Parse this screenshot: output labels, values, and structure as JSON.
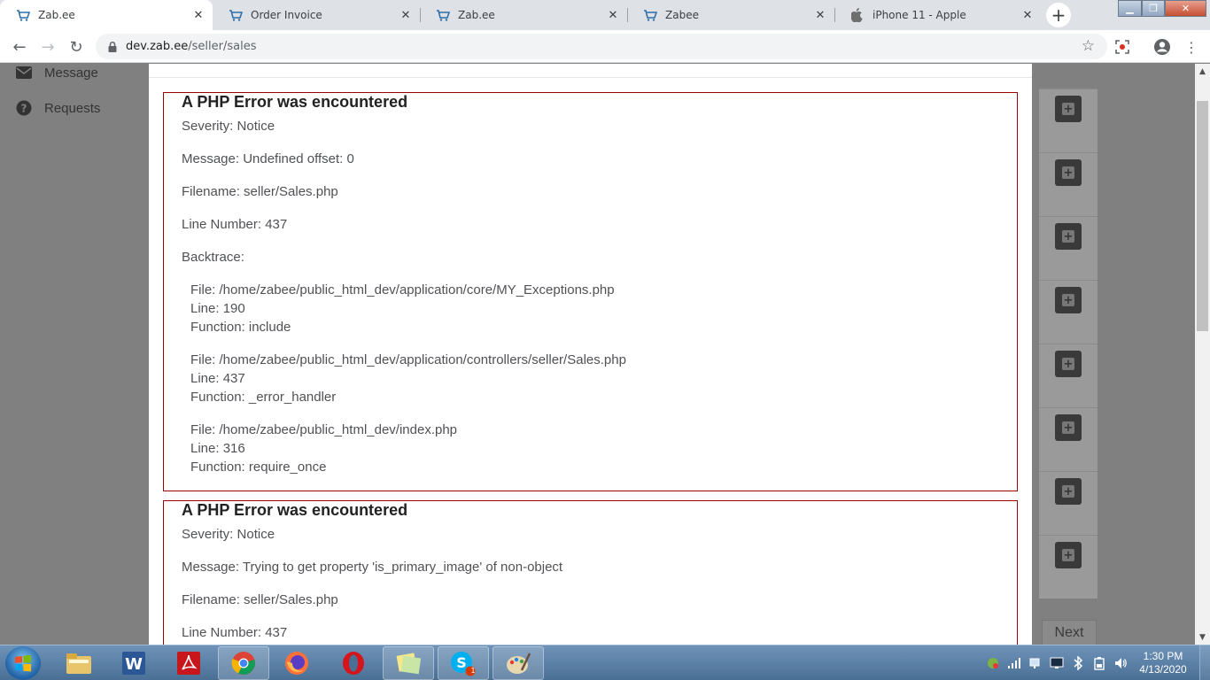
{
  "browser": {
    "tabs": [
      {
        "title": "Zab.ee",
        "favicon": "zabee-cart-icon",
        "active": true
      },
      {
        "title": "Order Invoice",
        "favicon": "zabee-cart-icon",
        "active": false
      },
      {
        "title": "Zab.ee",
        "favicon": "zabee-cart-icon",
        "active": false
      },
      {
        "title": "Zabee",
        "favicon": "zabee-cart-icon",
        "active": false
      },
      {
        "title": "iPhone 11 - Apple",
        "favicon": "apple-icon",
        "active": false
      }
    ],
    "address": {
      "host": "dev.zab.ee",
      "path": "/seller/sales"
    }
  },
  "sidebar": {
    "items": [
      {
        "label": "Message",
        "icon": "envelope-icon"
      },
      {
        "label": "Requests",
        "icon": "question-circle-icon"
      }
    ]
  },
  "errors": [
    {
      "heading": "A PHP Error was encountered",
      "severity": "Severity: Notice",
      "message": "Message: Undefined offset: 0",
      "filename": "Filename: seller/Sales.php",
      "line": "Line Number: 437",
      "backtrace_label": "Backtrace:",
      "backtrace": [
        {
          "file": "File: /home/zabee/public_html_dev/application/core/MY_Exceptions.php",
          "line": "Line: 190",
          "function": "Function: include"
        },
        {
          "file": "File: /home/zabee/public_html_dev/application/controllers/seller/Sales.php",
          "line": "Line: 437",
          "function": "Function: _error_handler"
        },
        {
          "file": "File: /home/zabee/public_html_dev/index.php",
          "line": "Line: 316",
          "function": "Function: require_once"
        }
      ]
    },
    {
      "heading": "A PHP Error was encountered",
      "severity": "Severity: Notice",
      "message": "Message: Trying to get property 'is_primary_image' of non-object",
      "filename": "Filename: seller/Sales.php",
      "line": "Line Number: 437"
    }
  ],
  "table": {
    "next_label": "Next"
  },
  "taskbar": {
    "apps": [
      "file-explorer-icon",
      "word-icon",
      "acrobat-icon",
      "chrome-icon",
      "firefox-icon",
      "opera-icon",
      "sticky-notes-icon",
      "skype-icon",
      "paint-icon"
    ],
    "skype_badge": "1",
    "time": "1:30 PM",
    "date": "4/13/2020"
  },
  "colors": {
    "error_border": "#990000",
    "overlay": "#808080",
    "taskbar": "#4a6f95"
  }
}
